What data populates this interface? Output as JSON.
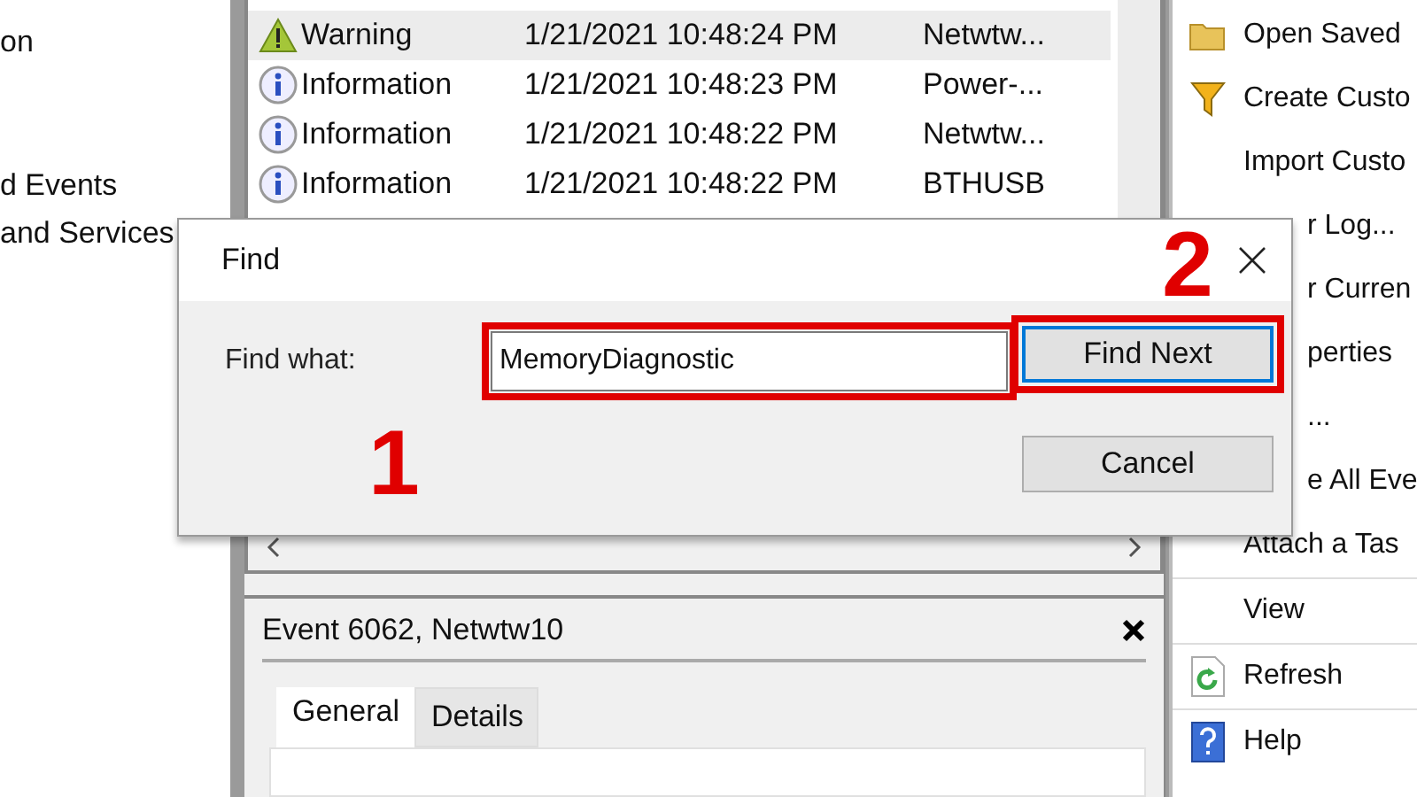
{
  "tree": {
    "items": [
      {
        "label": "on"
      },
      {
        "label": "d Events"
      },
      {
        "label": "and Services"
      }
    ]
  },
  "events": {
    "rows": [
      {
        "level": "Warning",
        "kind": "warning",
        "date": "1/21/2021 10:48:24 PM",
        "source": "Netwtw...",
        "selected": true
      },
      {
        "level": "Information",
        "kind": "info",
        "date": "1/21/2021 10:48:23 PM",
        "source": "Power-...",
        "selected": false
      },
      {
        "level": "Information",
        "kind": "info",
        "date": "1/21/2021 10:48:22 PM",
        "source": "Netwtw...",
        "selected": false
      },
      {
        "level": "Information",
        "kind": "info",
        "date": "1/21/2021 10:48:22 PM",
        "source": "BTHUSB",
        "selected": false
      }
    ]
  },
  "details": {
    "title": "Event 6062, Netwtw10",
    "tabs": [
      {
        "label": "General",
        "selected": true
      },
      {
        "label": "Details",
        "selected": false
      }
    ]
  },
  "actions": [
    {
      "label": "Open Saved",
      "kind": "folder"
    },
    {
      "label": "Create Custo",
      "kind": "filter"
    },
    {
      "label": "Import Custo",
      "kind": "plain"
    },
    {
      "label": "r Log...",
      "kind": "partial"
    },
    {
      "label": "r Curren",
      "kind": "partial"
    },
    {
      "label": "perties",
      "kind": "partial"
    },
    {
      "label": "...",
      "kind": "partial"
    },
    {
      "label": "e All Eve",
      "kind": "partial"
    },
    {
      "label": "Attach a Tas",
      "kind": "plain"
    },
    {
      "label": "View",
      "kind": "plain"
    },
    {
      "label": "Refresh",
      "kind": "refresh"
    },
    {
      "label": "Help",
      "kind": "help"
    }
  ],
  "dialog": {
    "title": "Find",
    "label": "Find what:",
    "value": "MemoryDiagnostic",
    "buttons": [
      {
        "label": "Find Next",
        "default": true
      },
      {
        "label": "Cancel",
        "default": false
      }
    ]
  },
  "annotations": [
    {
      "label": "1"
    },
    {
      "label": "2"
    }
  ]
}
